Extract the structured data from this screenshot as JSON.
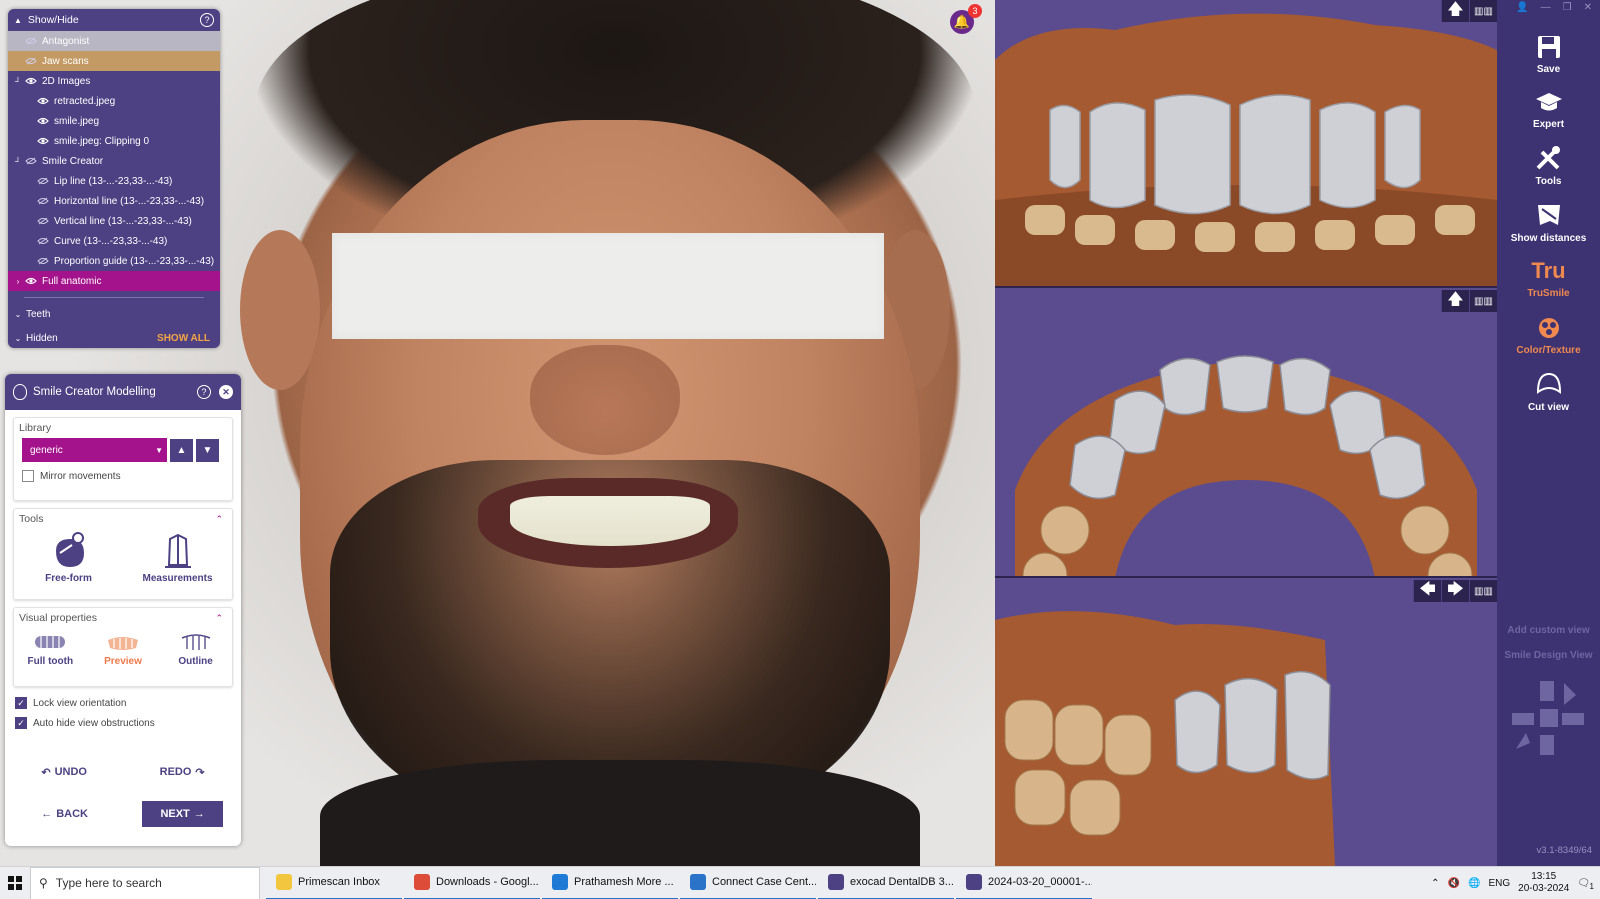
{
  "showhide": {
    "title": "Show/Hide",
    "items": [
      {
        "label": "Antagonist",
        "level": 1,
        "style": "sel-grey",
        "eye": "hidden"
      },
      {
        "label": "Jaw scans",
        "level": 1,
        "style": "sel-tan",
        "eye": "hidden"
      },
      {
        "label": "2D Images",
        "level": 1,
        "style": "",
        "eye": "visible",
        "expand": "open"
      },
      {
        "label": "retracted.jpeg",
        "level": 2,
        "style": "",
        "eye": "visible"
      },
      {
        "label": "smile.jpeg",
        "level": 2,
        "style": "",
        "eye": "visible"
      },
      {
        "label": "smile.jpeg: Clipping 0",
        "level": 2,
        "style": "",
        "eye": "visible"
      },
      {
        "label": "Smile Creator",
        "level": 1,
        "style": "",
        "eye": "hidden",
        "expand": "open"
      },
      {
        "label": "Lip line (13-...-23,33-...-43)",
        "level": 2,
        "style": "",
        "eye": "hidden"
      },
      {
        "label": "Horizontal line (13-...-23,33-...-43)",
        "level": 2,
        "style": "",
        "eye": "hidden"
      },
      {
        "label": "Vertical line (13-...-23,33-...-43)",
        "level": 2,
        "style": "",
        "eye": "hidden"
      },
      {
        "label": "Curve (13-...-23,33-...-43)",
        "level": 2,
        "style": "",
        "eye": "hidden"
      },
      {
        "label": "Proportion guide (13-...-23,33-...-43)",
        "level": 2,
        "style": "",
        "eye": "hidden"
      },
      {
        "label": "Full anatomic",
        "level": 1,
        "style": "sel-mag",
        "eye": "visible",
        "expand": "closed"
      }
    ],
    "teeth_label": "Teeth",
    "hidden_label": "Hidden",
    "show_all": "SHOW ALL"
  },
  "notification": {
    "count": "3"
  },
  "modelling": {
    "title": "Smile Creator Modelling",
    "library": {
      "title": "Library",
      "selected": "generic",
      "mirror_label": "Mirror movements",
      "mirror_checked": false
    },
    "tools": {
      "title": "Tools",
      "items": [
        {
          "label": "Free-form"
        },
        {
          "label": "Measurements"
        }
      ]
    },
    "visual": {
      "title": "Visual properties",
      "items": [
        {
          "label": "Full tooth"
        },
        {
          "label": "Preview"
        },
        {
          "label": "Outline"
        }
      ]
    },
    "lock_label": "Lock view orientation",
    "autohide_label": "Auto hide view obstructions",
    "undo": "UNDO",
    "redo": "REDO",
    "back": "BACK",
    "next": "NEXT"
  },
  "toolbar": {
    "items": [
      {
        "label": "Save",
        "icon": "save-icon"
      },
      {
        "label": "Expert",
        "icon": "graduation-cap-icon"
      },
      {
        "label": "Tools",
        "icon": "tools-icon"
      },
      {
        "label": "Show distances",
        "icon": "tooth-distance-icon"
      },
      {
        "label": "TruSmile",
        "icon": "trusmile-icon"
      },
      {
        "label": "Color/Texture",
        "icon": "color-texture-icon"
      },
      {
        "label": "Cut view",
        "icon": "cut-view-icon"
      }
    ],
    "add_custom_view": "Add custom view",
    "smile_design_view": "Smile Design View",
    "version": "v3.1-8349/64",
    "trusmile_text": "Tru"
  },
  "taskbar": {
    "search_placeholder": "Type here to search",
    "tasks": [
      {
        "label": "Primescan Inbox",
        "color": "#f3c63f"
      },
      {
        "label": "Downloads - Googl...",
        "color": "#dd4b39"
      },
      {
        "label": "Prathamesh More ...",
        "color": "#1e7ad4"
      },
      {
        "label": "Connect Case Cent...",
        "color": "#2b73c9"
      },
      {
        "label": "exocad DentalDB 3....",
        "color": "#4d4183"
      },
      {
        "label": "2024-03-20_00001-...",
        "color": "#4d4183"
      }
    ],
    "lang": "ENG",
    "time": "13:15",
    "date": "20-03-2024",
    "notif_count": "1"
  }
}
